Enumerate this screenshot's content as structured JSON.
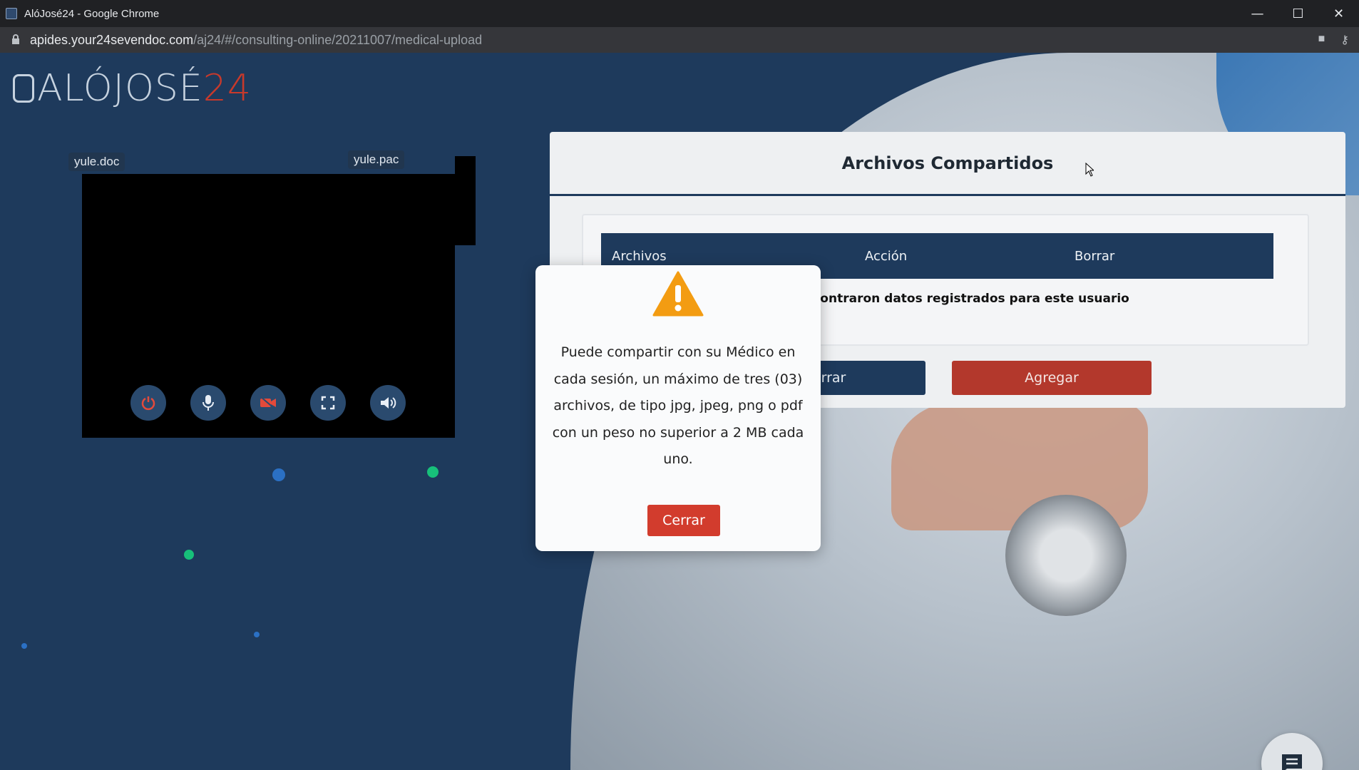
{
  "browser": {
    "window_title": "AlóJosé24 - Google Chrome",
    "url_host": "apides.your24sevendoc.com",
    "url_path": "/aj24/#/consulting-online/20211007/medical-upload"
  },
  "logo": {
    "text": "ALÓJOSÉ",
    "num": "24"
  },
  "video": {
    "local_name": "yule.doc",
    "remote_name": "yule.pac",
    "controls": [
      "power-icon",
      "microphone-icon",
      "camera-off-icon",
      "fullscreen-icon",
      "volume-icon"
    ]
  },
  "shared_files": {
    "title": "Archivos Compartidos",
    "columns": [
      "Archivos",
      "Acción",
      "Borrar"
    ],
    "empty_message": "ncontraron datos registrados para este usuario",
    "close_button_partial": "rrar",
    "add_button": "Agregar"
  },
  "modal": {
    "icon": "warning-icon",
    "message": "Puede compartir con su Médico en cada sesión, un máximo de tres (03) archivos, de tipo jpg, jpeg, png o pdf con un peso no superior a 2 MB cada uno.",
    "close_button": "Cerrar"
  },
  "colors": {
    "primary": "#1e3a5c",
    "danger": "#d23c2d",
    "warning": "#f39c12"
  }
}
